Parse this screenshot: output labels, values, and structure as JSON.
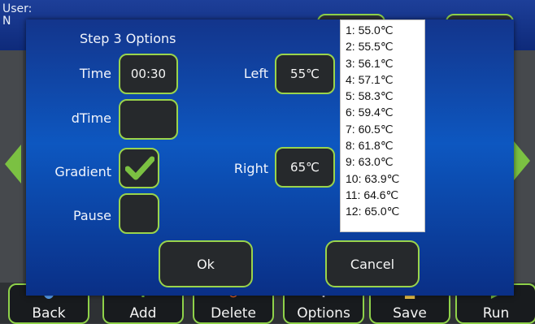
{
  "background": {
    "user_label": "User:",
    "user_line2": "N",
    "nav": {
      "left": "chevron-left-icon",
      "right": "chevron-right-icon"
    },
    "bottom_buttons": [
      {
        "label": "Back",
        "icon": "back-icon"
      },
      {
        "label": "Add",
        "icon": "add-icon"
      },
      {
        "label": "Delete",
        "icon": "delete-icon"
      },
      {
        "label": "Options",
        "icon": "gear-icon"
      },
      {
        "label": "Save",
        "icon": "save-icon"
      },
      {
        "label": "Run",
        "icon": "run-icon"
      }
    ]
  },
  "dialog": {
    "title": "Step 3 Options",
    "time_label": "Time",
    "time_value": "00:30",
    "dtime_label": "dTime",
    "dtime_value": "",
    "gradient_label": "Gradient",
    "gradient_checked": true,
    "pause_label": "Pause",
    "pause_checked": false,
    "left_label": "Left",
    "left_value": "55℃",
    "right_label": "Right",
    "right_value": "65℃",
    "ok_label": "Ok",
    "cancel_label": "Cancel",
    "gradient_list": [
      "1: 55.0℃",
      "2: 55.5℃",
      "3: 56.1℃",
      "4: 57.1℃",
      "5: 58.3℃",
      "6: 59.4℃",
      "7: 60.5℃",
      "8: 61.8℃",
      "9: 63.0℃",
      "10: 63.9℃",
      "11: 64.6℃",
      "12: 65.0℃"
    ]
  },
  "colors": {
    "accent_green": "#9ad44b",
    "dialog_blue": "#0d57c0",
    "field_dark": "#26292c"
  }
}
